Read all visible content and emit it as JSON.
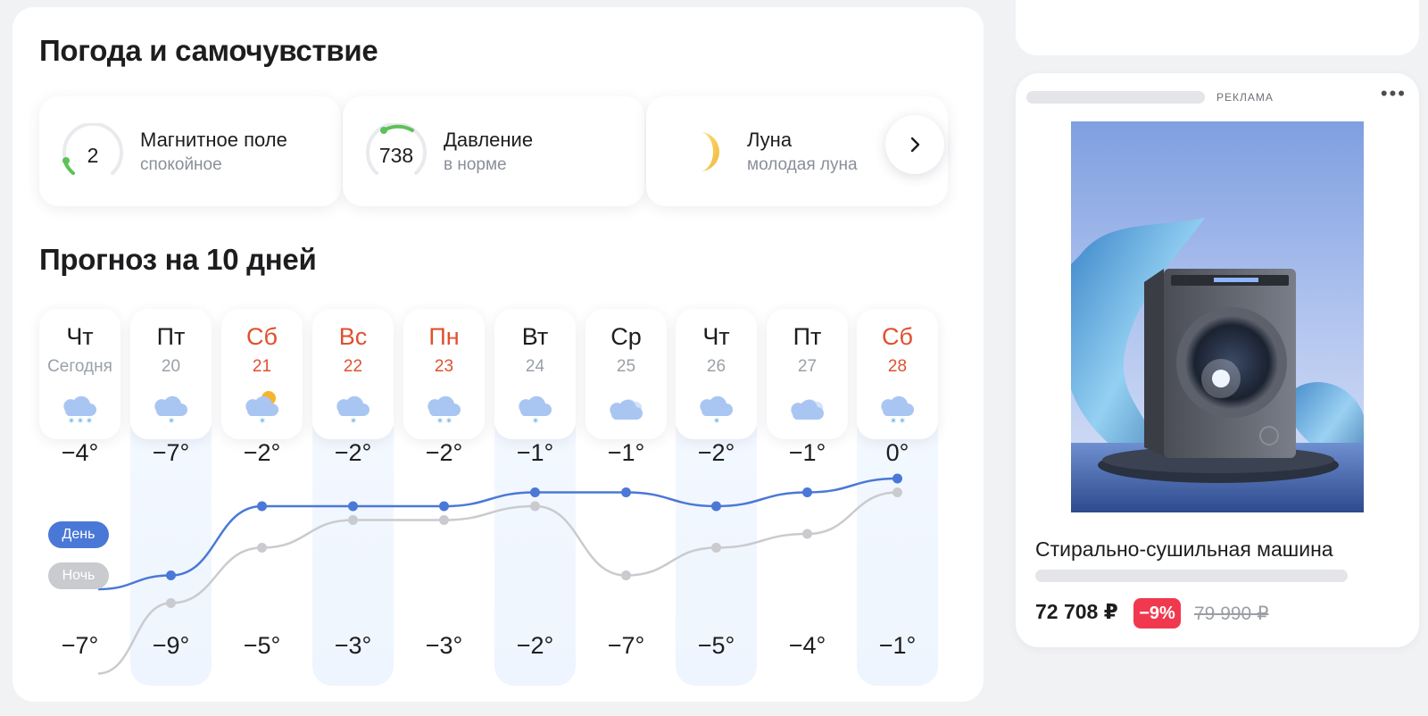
{
  "wellbeing": {
    "title": "Погода и самочувствие",
    "tiles": [
      {
        "title": "Магнитное поле",
        "value": "2",
        "subtitle": "спокойное",
        "icon": "magnetic-gauge-icon"
      },
      {
        "title": "Давление",
        "value": "738",
        "subtitle": "в норме",
        "icon": "pressure-gauge-icon"
      },
      {
        "title": "Луна",
        "subtitle": "молодая луна",
        "icon": "moon-icon"
      }
    ],
    "next_icon": "chevron-right-icon"
  },
  "forecast": {
    "title": "Прогноз на 10 дней",
    "legend": {
      "day": "День",
      "night": "Ночь"
    },
    "colors": {
      "day": "#4a78d6",
      "night": "#c6c8cc",
      "weekend": "#e0502f",
      "day_pill": "#4a78d6",
      "night_pill": "#c6c8cc"
    },
    "days": [
      {
        "name": "Чт",
        "date": "Сегодня",
        "weekend": false,
        "icon": "cloud-heavy-snow-icon",
        "day": "−4°",
        "night": "−7°"
      },
      {
        "name": "Пт",
        "date": "20",
        "weekend": false,
        "icon": "cloud-light-snow-icon",
        "day": "−7°",
        "night": "−9°"
      },
      {
        "name": "Сб",
        "date": "21",
        "weekend": true,
        "icon": "sun-cloud-snow-icon",
        "day": "−2°",
        "night": "−5°"
      },
      {
        "name": "Вс",
        "date": "22",
        "weekend": true,
        "icon": "cloud-light-snow-icon",
        "day": "−2°",
        "night": "−3°"
      },
      {
        "name": "Пн",
        "date": "23",
        "weekend": true,
        "icon": "cloud-snow-icon",
        "day": "−2°",
        "night": "−3°"
      },
      {
        "name": "Вт",
        "date": "24",
        "weekend": false,
        "icon": "cloud-light-snow-icon",
        "day": "−1°",
        "night": "−2°"
      },
      {
        "name": "Ср",
        "date": "25",
        "weekend": false,
        "icon": "overcast-icon",
        "day": "−1°",
        "night": "−7°"
      },
      {
        "name": "Чт",
        "date": "26",
        "weekend": false,
        "icon": "cloud-light-snow-icon",
        "day": "−2°",
        "night": "−5°"
      },
      {
        "name": "Пт",
        "date": "27",
        "weekend": false,
        "icon": "overcast-icon",
        "day": "−1°",
        "night": "−4°"
      },
      {
        "name": "Сб",
        "date": "28",
        "weekend": true,
        "icon": "cloud-snow-icon",
        "day": "0°",
        "night": "−1°"
      }
    ],
    "day_values": [
      -4,
      -7,
      -2,
      -2,
      -2,
      -1,
      -1,
      -2,
      -1,
      0
    ],
    "night_values": [
      -7,
      -9,
      -5,
      -3,
      -3,
      -2,
      -7,
      -5,
      -4,
      -1
    ]
  },
  "ad": {
    "label": "РЕКЛАМА",
    "menu_icon": "more-dots-icon",
    "image": "washing-machine-photo",
    "title": "Стирально-сушильная машина",
    "price": "72 708 ₽",
    "discount": "−9%",
    "old_price": "79 990 ₽",
    "colors": {
      "discount": "#f0394f"
    }
  }
}
